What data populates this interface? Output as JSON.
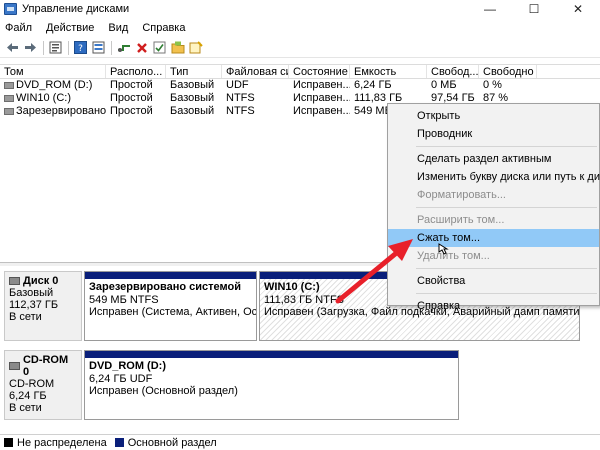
{
  "window": {
    "title": "Управление дисками",
    "minimize": "—",
    "maximize": "☐",
    "close": "✕"
  },
  "menu": [
    "Файл",
    "Действие",
    "Вид",
    "Справка"
  ],
  "toolbar": [
    "back-arrow-icon",
    "forward-arrow-icon",
    "properties-icon",
    "help-icon",
    "connect-icon",
    "delete-icon",
    "check-icon",
    "folder-icon",
    "wizard-icon"
  ],
  "volumes": {
    "columns": [
      "Том",
      "Располо...",
      "Тип",
      "Файловая система",
      "Состояние",
      "Емкость",
      "Свобод...",
      "Свободно %"
    ],
    "rows": [
      [
        "DVD_ROM (D:)",
        "Простой",
        "Базовый",
        "UDF",
        "Исправен...",
        "6,24 ГБ",
        "0 МБ",
        "0 %"
      ],
      [
        "WIN10 (C:)",
        "Простой",
        "Базовый",
        "NTFS",
        "Исправен...",
        "111,83 ГБ",
        "97,54 ГБ",
        "87 %"
      ],
      [
        "Зарезервировано...",
        "Простой",
        "Базовый",
        "NTFS",
        "Исправен...",
        "549 МБ",
        "",
        ""
      ]
    ]
  },
  "disks": [
    {
      "name": "Диск 0",
      "type": "Базовый",
      "size": "112,37 ГБ",
      "status": "В сети",
      "partitions": [
        {
          "title": "Зарезервировано системой",
          "size": "549 МБ NTFS",
          "status": "Исправен (Система, Активен, Основн"
        },
        {
          "title": "WIN10  (C:)",
          "size": "111,83 ГБ NTFS",
          "status": "Исправен (Загрузка, Файл подкачки, Аварийный дамп памяти, Осн"
        }
      ]
    },
    {
      "name": "CD-ROM 0",
      "type": "CD-ROM",
      "size": "6,24 ГБ",
      "status": "В сети",
      "partitions": [
        {
          "title": "DVD_ROM  (D:)",
          "size": "6,24 ГБ UDF",
          "status": "Исправен (Основной раздел)"
        }
      ]
    }
  ],
  "legend": [
    {
      "label": "Не распределена",
      "color": "#000000"
    },
    {
      "label": "Основной раздел",
      "color": "#0a1f7a"
    }
  ],
  "context_menu": {
    "items": [
      {
        "label": "Открыть",
        "disabled": false
      },
      {
        "label": "Проводник",
        "disabled": false
      },
      {
        "sep": true
      },
      {
        "label": "Сделать раздел активным",
        "disabled": false
      },
      {
        "label": "Изменить букву диска или путь к диску...",
        "disabled": false
      },
      {
        "label": "Форматировать...",
        "disabled": true
      },
      {
        "sep": true
      },
      {
        "label": "Расширить том...",
        "disabled": true
      },
      {
        "label": "Сжать том...",
        "disabled": false,
        "highlighted": true
      },
      {
        "label": "Удалить том...",
        "disabled": true
      },
      {
        "sep": true
      },
      {
        "label": "Свойства",
        "disabled": false
      },
      {
        "sep": true
      },
      {
        "label": "Справка",
        "disabled": false
      }
    ]
  },
  "colors": {
    "accent": "#0a1f7a",
    "highlight": "#91c9f7",
    "annotation_arrow": "#e8202a"
  }
}
